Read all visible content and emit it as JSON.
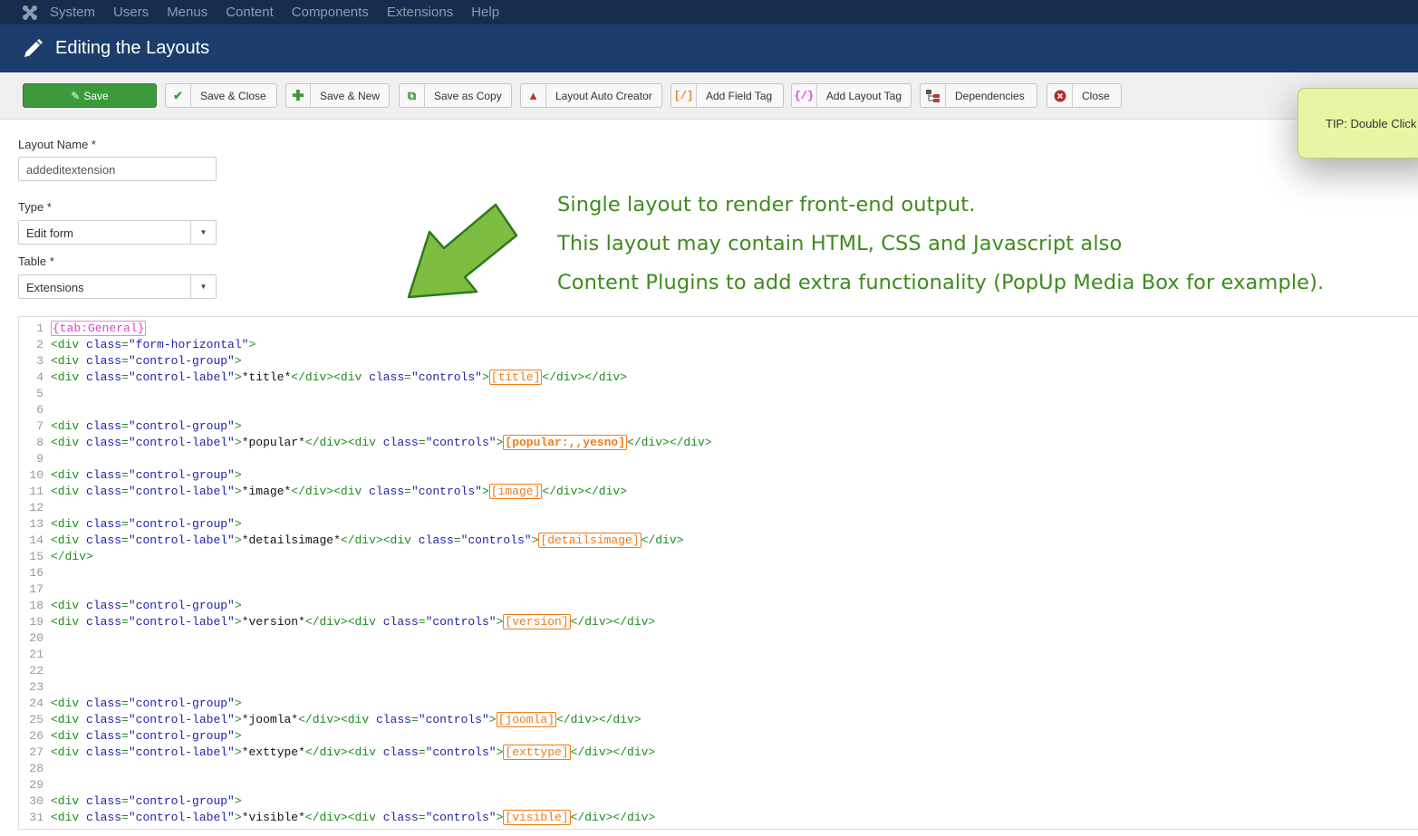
{
  "topnav": {
    "items": [
      "System",
      "Users",
      "Menus",
      "Content",
      "Components",
      "Extensions",
      "Help"
    ]
  },
  "page": {
    "title": "Editing the Layouts"
  },
  "toolbar": {
    "buttons": [
      {
        "label": "Save"
      },
      {
        "label": "Save & Close"
      },
      {
        "label": "Save & New"
      },
      {
        "label": "Save as Copy"
      },
      {
        "label": "Layout Auto Creator"
      },
      {
        "label": "Add Field Tag"
      },
      {
        "label": "Add Layout Tag"
      },
      {
        "label": "Dependencies"
      },
      {
        "label": "Close"
      }
    ]
  },
  "tip": {
    "text": "TIP: Double Click"
  },
  "form": {
    "layout_name_label": "Layout Name *",
    "layout_name_value": "addeditextension",
    "type_label": "Type *",
    "type_value": "Edit form",
    "table_label": "Table *",
    "table_value": "Extensions"
  },
  "annotation": {
    "lines": [
      "Single layout to render front-end output.",
      "This layout may contain HTML, CSS and Javascript also",
      "Content Plugins to add extra functionality (PopUp Media Box for example)."
    ]
  },
  "editor": {
    "lines": [
      {
        "n": "1",
        "kind": "tab",
        "tag": "{tab:General}"
      },
      {
        "n": "2",
        "kind": "open",
        "cls": "form-horizontal"
      },
      {
        "n": "3",
        "kind": "open",
        "cls": "control-group"
      },
      {
        "n": "4",
        "kind": "field",
        "label": "*title*",
        "tag": "[title]",
        "tail": "</div></div>"
      },
      {
        "n": "5",
        "kind": "blank"
      },
      {
        "n": "6",
        "kind": "blank"
      },
      {
        "n": "7",
        "kind": "open",
        "cls": "control-group"
      },
      {
        "n": "8",
        "kind": "field",
        "label": "*popular*",
        "tag": "[popular:,,yesno]",
        "bold": true,
        "tail": "</div></div>"
      },
      {
        "n": "9",
        "kind": "blank"
      },
      {
        "n": "10",
        "kind": "open",
        "cls": "control-group"
      },
      {
        "n": "11",
        "kind": "field",
        "label": "*image*",
        "tag": "[image]",
        "tail": "</div></div>"
      },
      {
        "n": "12",
        "kind": "blank"
      },
      {
        "n": "13",
        "kind": "open",
        "cls": "control-group"
      },
      {
        "n": "14",
        "kind": "field",
        "label": "*detailsimage*",
        "tag": "[detailsimage]",
        "tail": "</div>"
      },
      {
        "n": "15",
        "kind": "close",
        "text": "</div>"
      },
      {
        "n": "16",
        "kind": "blank"
      },
      {
        "n": "17",
        "kind": "blank"
      },
      {
        "n": "18",
        "kind": "open",
        "cls": "control-group"
      },
      {
        "n": "19",
        "kind": "field",
        "label": "*version*",
        "tag": "[version]",
        "tail": "</div></div>"
      },
      {
        "n": "20",
        "kind": "blank"
      },
      {
        "n": "21",
        "kind": "blank"
      },
      {
        "n": "22",
        "kind": "blank"
      },
      {
        "n": "23",
        "kind": "blank"
      },
      {
        "n": "24",
        "kind": "open",
        "cls": "control-group"
      },
      {
        "n": "25",
        "kind": "field",
        "label": "*joomla*",
        "tag": "[joomla]",
        "tail": "</div></div>"
      },
      {
        "n": "26",
        "kind": "open",
        "cls": "control-group"
      },
      {
        "n": "27",
        "kind": "field",
        "label": "*exttype*",
        "tag": "[exttype]",
        "tail": "</div></div>"
      },
      {
        "n": "28",
        "kind": "blank"
      },
      {
        "n": "29",
        "kind": "blank"
      },
      {
        "n": "30",
        "kind": "open",
        "cls": "control-group"
      },
      {
        "n": "31",
        "kind": "field",
        "label": "*visible*",
        "tag": "[visible]",
        "tail": "</div></div>"
      }
    ]
  },
  "colors": {
    "topnav_bg": "#172d4d",
    "titlebar_bg": "#1c3d6b",
    "save_green": "#3c9a3c",
    "annotation_green": "#3f8a1e",
    "field_tag_orange": "#f07b17",
    "tab_tag_magenta": "#d946c8",
    "tip_bg": "#e9f5a2"
  }
}
